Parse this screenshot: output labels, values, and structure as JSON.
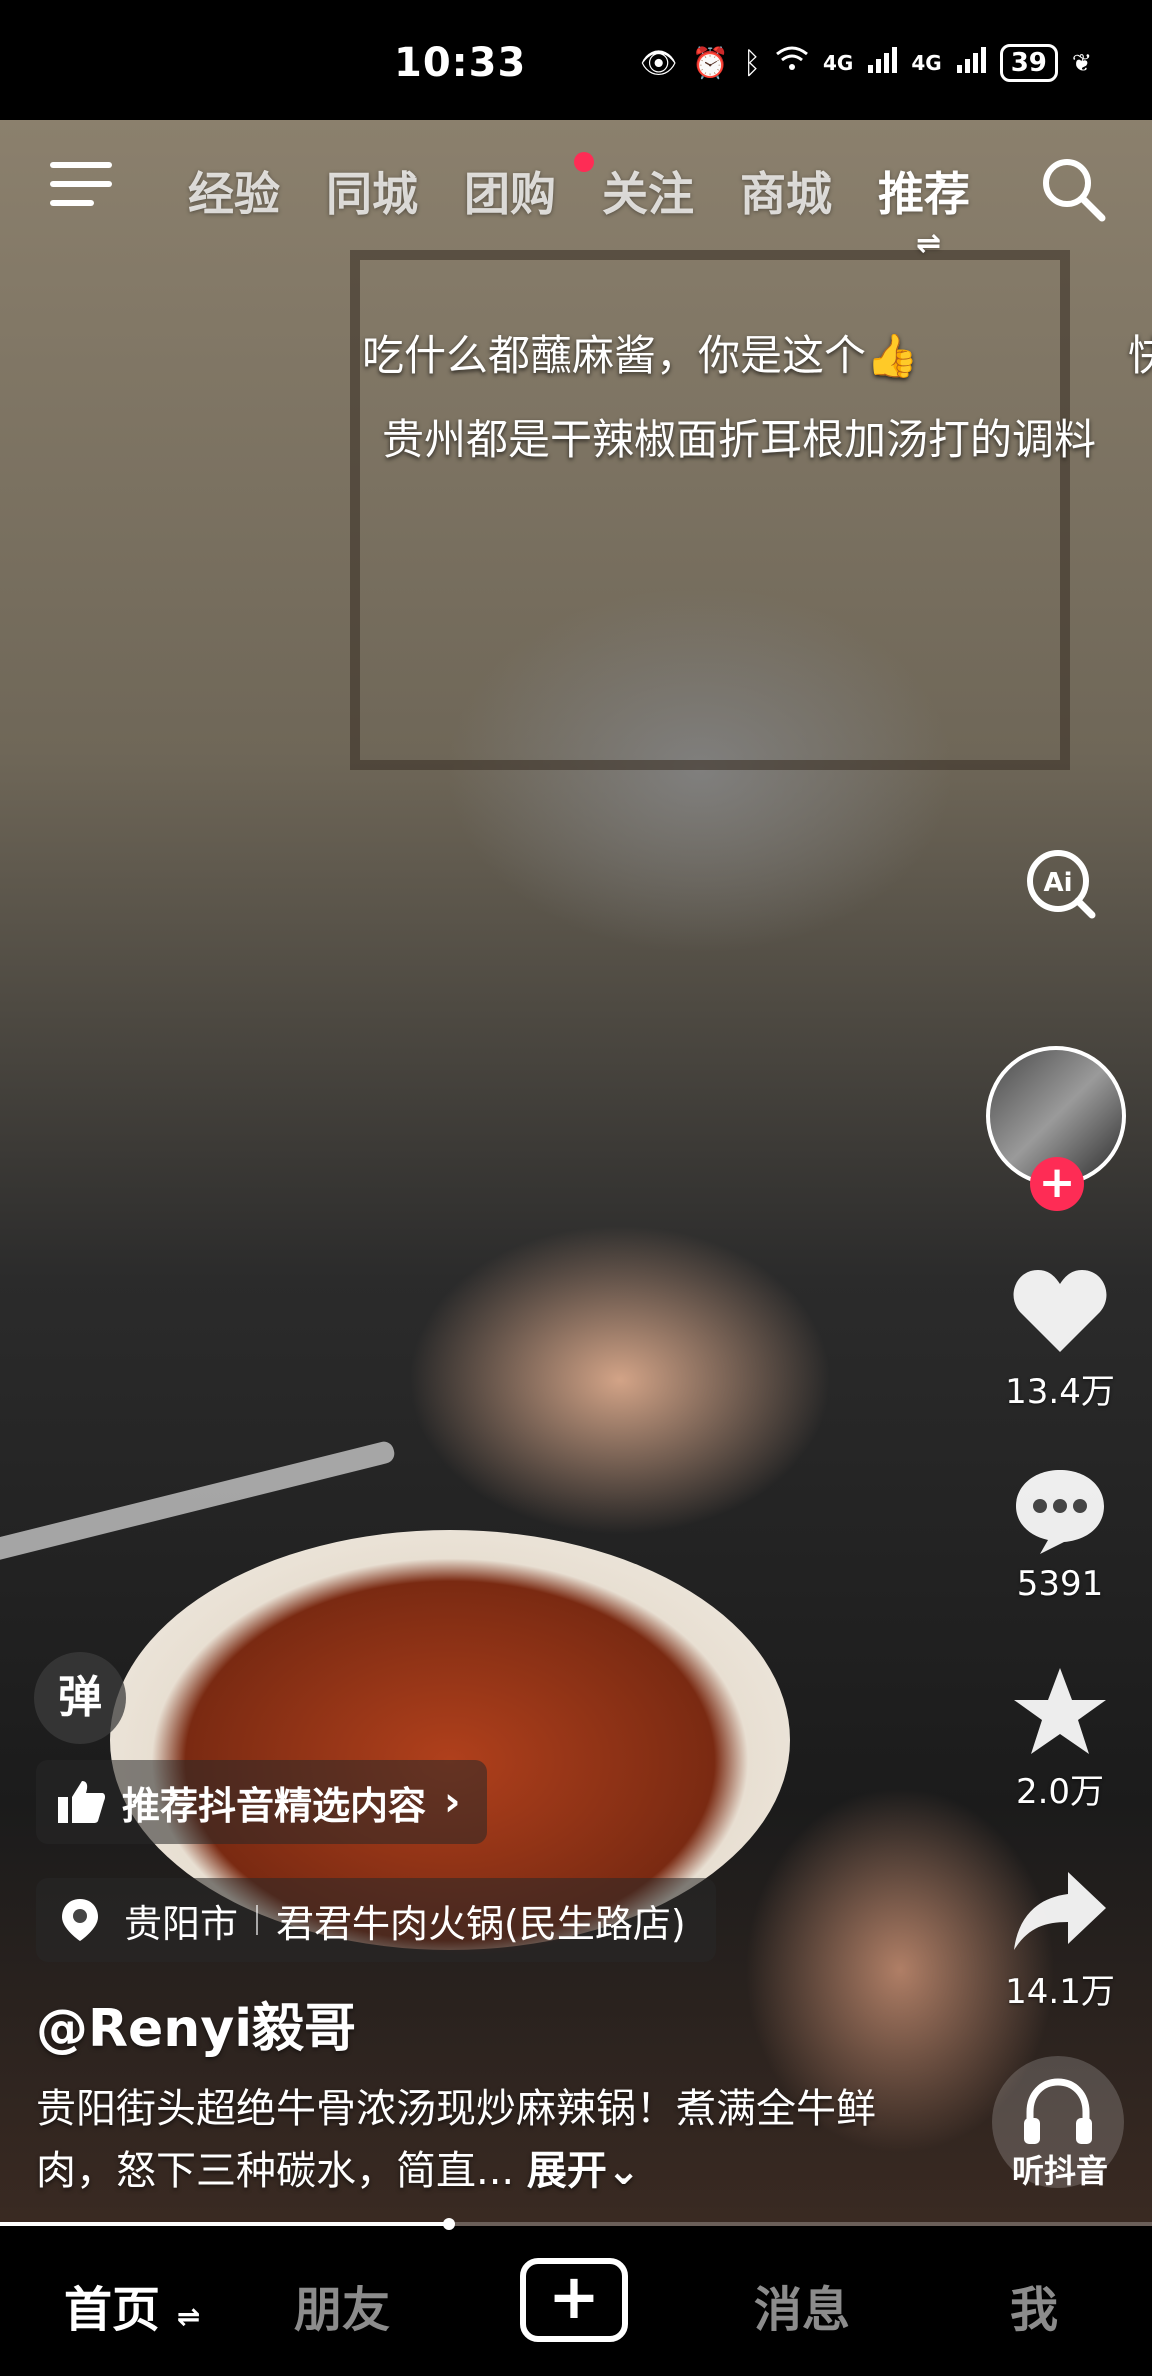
{
  "status_bar": {
    "time": "10:33",
    "network_1": "4G",
    "network_2": "4G",
    "battery": "39"
  },
  "top_nav": {
    "tabs": [
      {
        "label": "经验"
      },
      {
        "label": "同城"
      },
      {
        "label": "团购"
      },
      {
        "label": "关注"
      },
      {
        "label": "商城"
      },
      {
        "label": "推荐"
      }
    ],
    "active_tab": "推荐",
    "active_tab_indicator": "⇌"
  },
  "danmaku": {
    "line1": "吃什么都蘸麻酱，你是这个👍",
    "line1_extra": "快",
    "line2": "贵州都是干辣椒面折耳根加汤打的调料"
  },
  "right_rail": {
    "likes": "13.4万",
    "comments": "5391",
    "favorites": "2.0万",
    "shares": "14.1万",
    "listen_label": "听抖音"
  },
  "overlay": {
    "danmu_toggle": "弹",
    "recommend_text": "推荐抖音精选内容",
    "location_city": "贵阳市",
    "location_place": "君君牛肉火锅(民生路店)"
  },
  "post": {
    "author": "@Renyi毅哥",
    "description": "贵阳街头超绝牛骨浓汤现炒麻辣锅！煮满全牛鲜肉，怒下三种碳水，简直...",
    "expand_label": "展开"
  },
  "progress": {
    "played_fraction": 0.39
  },
  "bottom_nav": {
    "home": "首页",
    "home_indicator": "⇌",
    "friends": "朋友",
    "create": "+",
    "messages": "消息",
    "me": "我"
  },
  "colors": {
    "accent": "#fe2c55",
    "background": "#000000"
  }
}
